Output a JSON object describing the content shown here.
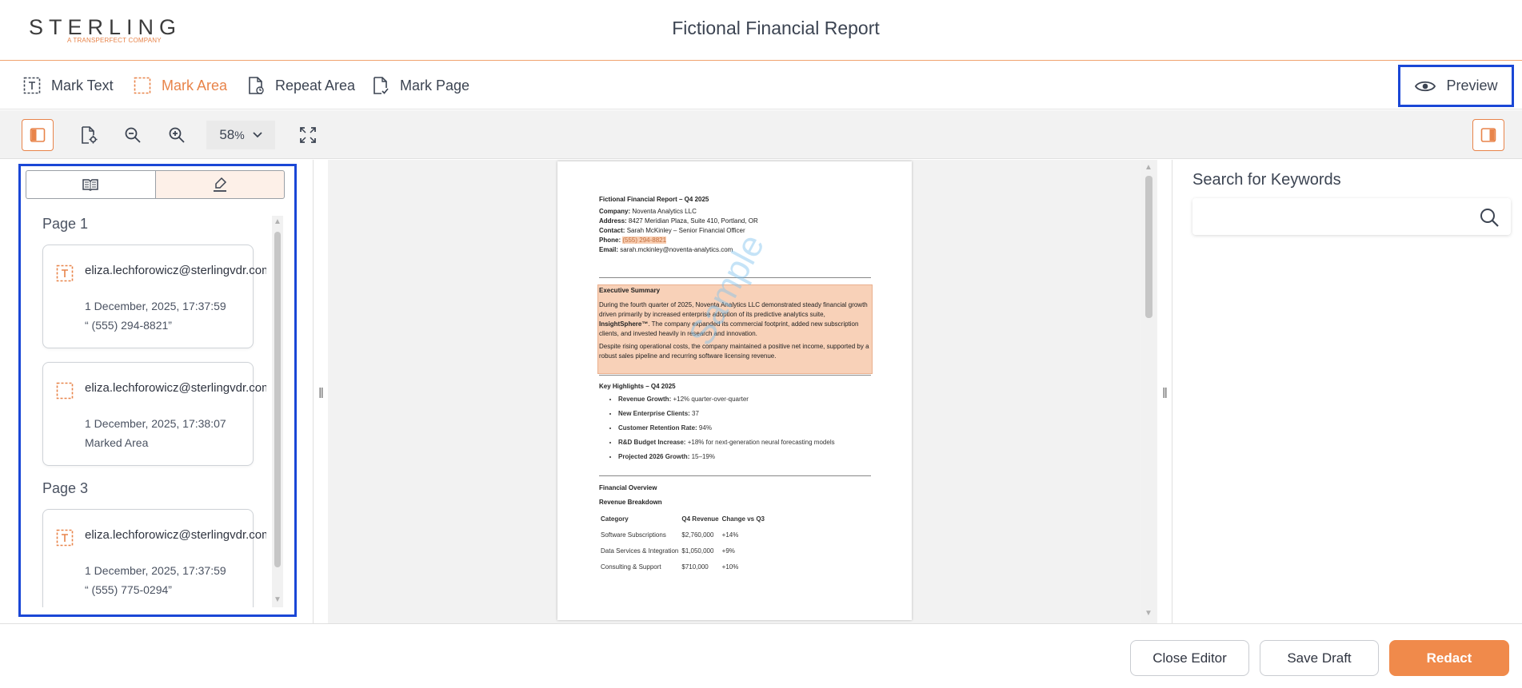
{
  "header": {
    "logo_word": "STERLING",
    "logo_sub": "A TRANSPERFECT COMPANY",
    "title": "Fictional Financial Report"
  },
  "markup_tools": [
    {
      "label": "Mark Text",
      "icon": "mark-text-icon",
      "active": false
    },
    {
      "label": "Mark Area",
      "icon": "mark-area-icon",
      "active": true
    },
    {
      "label": "Repeat Area",
      "icon": "repeat-area-icon",
      "active": false
    },
    {
      "label": "Mark Page",
      "icon": "mark-page-icon",
      "active": false
    }
  ],
  "preview_label": "Preview",
  "view_toolbar": {
    "zoom_value": "58",
    "zoom_unit": "%"
  },
  "left_panel": {
    "pages": [
      {
        "heading": "Page 1",
        "annotations": [
          {
            "type": "text",
            "user": "eliza.lechforowicz@sterlingvdr.com",
            "timestamp": "1 December, 2025, 17:37:59",
            "detail": "“ (555) 294-8821”"
          },
          {
            "type": "area",
            "user": "eliza.lechforowicz@sterlingvdr.com",
            "timestamp": "1 December, 2025, 17:38:07",
            "detail": "Marked Area"
          }
        ]
      },
      {
        "heading": "Page 3",
        "annotations": [
          {
            "type": "text",
            "user": "eliza.lechforowicz@sterlingvdr.com",
            "timestamp": "1 December, 2025, 17:37:59",
            "detail": "“ (555) 775-0294”"
          }
        ]
      }
    ]
  },
  "document": {
    "title": "Fictional Financial Report – Q4 2025",
    "company_label": "Company:",
    "company": "Noventa Analytics LLC",
    "address_label": "Address:",
    "address": "8427 Meridian Plaza, Suite 410, Portland, OR",
    "contact_label": "Contact:",
    "contact": "Sarah McKinley – Senior Financial Officer",
    "phone_label": "Phone:",
    "phone": "(555) 294-8821",
    "email_label": "Email:",
    "email": "sarah.mckinley@noventa-analytics.com",
    "exec_heading": "Executive Summary",
    "exec_p1a": "During the fourth quarter of 2025, Noventa Analytics LLC demonstrated steady financial growth driven primarily by increased enterprise adoption of its predictive analytics suite,",
    "exec_p1_brand": "InsightSphere™",
    "exec_p1b": ". The company expanded its commercial footprint, added new subscription clients, and invested heavily in research and innovation.",
    "exec_p2": "Despite rising operational costs, the company maintained a positive net income, supported by a robust sales pipeline and recurring software licensing revenue.",
    "highlights_heading": "Key Highlights – Q4 2025",
    "highlights": [
      {
        "label": "Revenue Growth:",
        "value": "+12% quarter-over-quarter"
      },
      {
        "label": "New Enterprise Clients:",
        "value": "37"
      },
      {
        "label": "Customer Retention Rate:",
        "value": "94%"
      },
      {
        "label": "R&D Budget Increase:",
        "value": "+18% for next-generation neural forecasting models"
      },
      {
        "label": "Projected 2026 Growth:",
        "value": "15–19%"
      }
    ],
    "fin_heading": "Financial Overview",
    "rev_heading": "Revenue Breakdown",
    "table_headers": [
      "Category",
      "Q4 Revenue",
      "Change vs Q3"
    ],
    "table_rows": [
      [
        "Software Subscriptions",
        "$2,760,000",
        "+14%"
      ],
      [
        "Data Services & Integration",
        "$1,050,000",
        "+9%"
      ],
      [
        "Consulting & Support",
        "$710,000",
        "+10%"
      ]
    ],
    "watermark": "Sample"
  },
  "right_panel": {
    "title": "Search for Keywords",
    "search_value": "",
    "search_placeholder": ""
  },
  "footer": {
    "close_label": "Close Editor",
    "save_label": "Save Draft",
    "redact_label": "Redact"
  },
  "colors": {
    "accent": "#e8844a",
    "primary_button": "#f08a4b",
    "focus_outline": "#1a47d6",
    "redaction_fill": "#f8cdb1"
  }
}
